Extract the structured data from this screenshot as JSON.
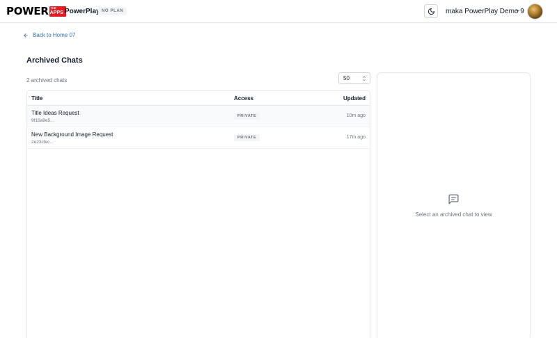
{
  "header": {
    "logo_text": "POWER",
    "logo_badge_small": "THE",
    "logo_badge_big": "APPS",
    "app_name": "PowerPlay",
    "plan_badge": "NO PLAN",
    "theme_icon": "moon-icon",
    "user_name": "maka PowerPlay Demo 9",
    "user_menu_icon": "chevron-down-icon"
  },
  "nav": {
    "back_icon": "arrow-left-icon",
    "back_label": "Back to Home 07"
  },
  "page": {
    "title": "Archived Chats",
    "count_text": "2 archived chats",
    "page_size": "50"
  },
  "table": {
    "columns": {
      "title": "Title",
      "access": "Access",
      "updated": "Updated"
    },
    "rows": [
      {
        "title": "Title Ideas Request",
        "id": "9f16a9e5...",
        "access": "PRIVATE",
        "updated": "10m ago"
      },
      {
        "title": "New Background Image Request",
        "id": "2e23cfec...",
        "access": "PRIVATE",
        "updated": "17m ago"
      }
    ]
  },
  "preview": {
    "icon": "message-square-text-icon",
    "empty_text": "Select an archived chat to view"
  },
  "colors": {
    "accent_link": "#2f6fb0",
    "brand_red": "#e31b23",
    "border": "#e5e7eb",
    "muted_text": "#6b7280"
  }
}
